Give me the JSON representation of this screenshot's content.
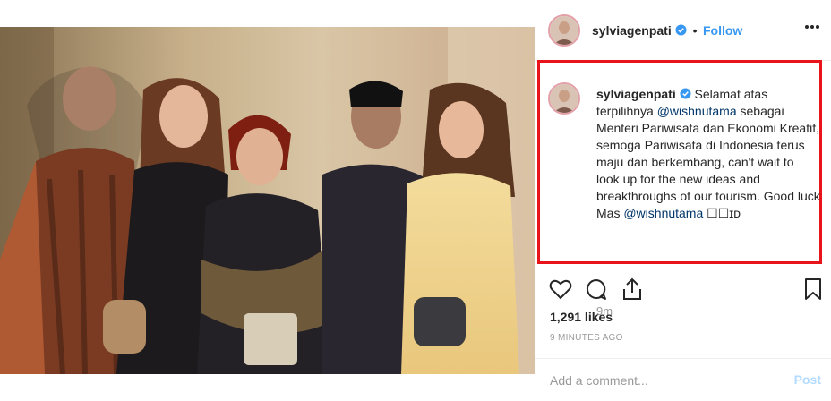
{
  "post": {
    "username": "sylviagenpati",
    "verified_icon": "verified-badge-icon",
    "follow_separator": "•",
    "follow_label": "Follow",
    "more_icon": "more-options-icon"
  },
  "caption": {
    "username": "sylviagenpati",
    "parts": [
      {
        "text": "Selamat atas terpilihnya ",
        "type": "text"
      },
      {
        "text": "@wishnutama",
        "type": "mention"
      },
      {
        "text": " sebagai Menteri Pariwisata dan Ekonomi Kreatif, semoga Pariwisata di Indonesia terus maju dan berkembang, can't wait to look up for the new ideas and breakthroughs of our tourism. Good luck Mas ",
        "type": "text"
      },
      {
        "text": "@wishnutama",
        "type": "mention"
      },
      {
        "text": " ☐☐ɪᴅ",
        "type": "text"
      }
    ],
    "time": "9m"
  },
  "actions": {
    "like_icon": "heart-icon",
    "comment_icon": "comment-icon",
    "share_icon": "share-icon",
    "save_icon": "bookmark-icon"
  },
  "likes": "1,291 likes",
  "timestamp": "9 MINUTES AGO",
  "comment": {
    "placeholder": "Add a comment...",
    "post_label": "Post"
  },
  "colors": {
    "accent": "#3897f0",
    "highlight_border": "#e8141a",
    "post_disabled": "#b3dbff"
  }
}
